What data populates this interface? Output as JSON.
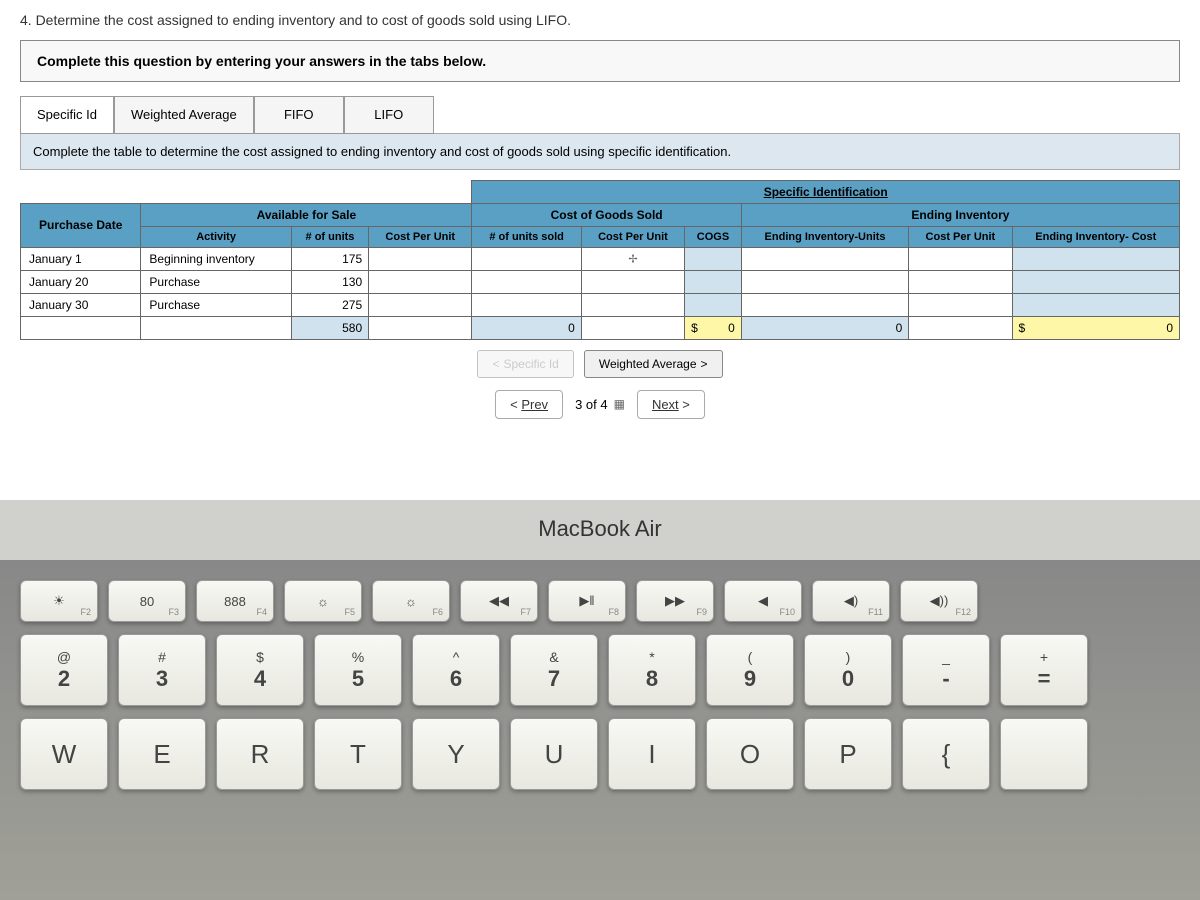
{
  "question_header": "4. Determine the cost assigned to ending inventory and to cost of goods sold using LIFO.",
  "instruction": "Complete this question by entering your answers in the tabs below.",
  "tabs": {
    "specific_id": "Specific Id",
    "weighted_avg": "Weighted Average",
    "fifo": "FIFO",
    "lifo": "LIFO"
  },
  "sub_instruction": "Complete the table to determine the cost assigned to ending inventory and cost of goods sold using specific identification.",
  "table": {
    "title": "Specific Identification",
    "sections": {
      "available": "Available for Sale",
      "cogs": "Cost of Goods Sold",
      "ending": "Ending Inventory"
    },
    "headers": {
      "purchase_date": "Purchase Date",
      "activity": "Activity",
      "num_units": "# of units",
      "cost_per_unit": "Cost Per Unit",
      "units_sold": "# of units sold",
      "cpu_sold": "Cost Per Unit",
      "cogs": "COGS",
      "ending_units": "Ending Inventory-Units",
      "cpu_end": "Cost Per Unit",
      "ending_cost": "Ending Inventory- Cost"
    },
    "rows": [
      {
        "date": "January 1",
        "activity": "Beginning inventory",
        "units": "175"
      },
      {
        "date": "January 20",
        "activity": "Purchase",
        "units": "130"
      },
      {
        "date": "January 30",
        "activity": "Purchase",
        "units": "275"
      }
    ],
    "totals": {
      "units": "580",
      "units_sold": "0",
      "cogs_sym": "$",
      "cogs_val": "0",
      "ending_units": "0",
      "ending_sym": "$",
      "ending_val": "0"
    }
  },
  "nav": {
    "prev_specific": "Specific Id",
    "next_weighted": "Weighted Average"
  },
  "pager": {
    "prev": "Prev",
    "info": "3 of 4",
    "next": "Next"
  },
  "laptop_brand": "MacBook Air",
  "keyboard": {
    "fn_row": [
      {
        "icon": "☀",
        "label": "F2"
      },
      {
        "icon": "⊞",
        "sub": "80",
        "label": "F3"
      },
      {
        "icon": "⊞",
        "sub": "888",
        "label": "F4"
      },
      {
        "icon": "☼",
        "label": "F5"
      },
      {
        "icon": "☼",
        "label": "F6"
      },
      {
        "icon": "◀◀",
        "label": "F7"
      },
      {
        "icon": "▶‖",
        "label": "F8"
      },
      {
        "icon": "▶▶",
        "label": "F9"
      },
      {
        "icon": "◀",
        "label": "F10"
      },
      {
        "icon": "◀)",
        "label": "F11"
      },
      {
        "icon": "◀))",
        "label": "F12"
      }
    ],
    "num_row": [
      {
        "top": "@",
        "bottom": "2"
      },
      {
        "top": "#",
        "bottom": "3"
      },
      {
        "top": "$",
        "bottom": "4"
      },
      {
        "top": "%",
        "bottom": "5"
      },
      {
        "top": "^",
        "bottom": "6"
      },
      {
        "top": "&",
        "bottom": "7"
      },
      {
        "top": "*",
        "bottom": "8"
      },
      {
        "top": "(",
        "bottom": "9"
      },
      {
        "top": ")",
        "bottom": "0"
      },
      {
        "top": "_",
        "bottom": "-"
      },
      {
        "top": "+",
        "bottom": "="
      }
    ],
    "letter_row": [
      "W",
      "E",
      "R",
      "T",
      "Y",
      "U",
      "I",
      "O",
      "P",
      "{",
      ""
    ]
  }
}
